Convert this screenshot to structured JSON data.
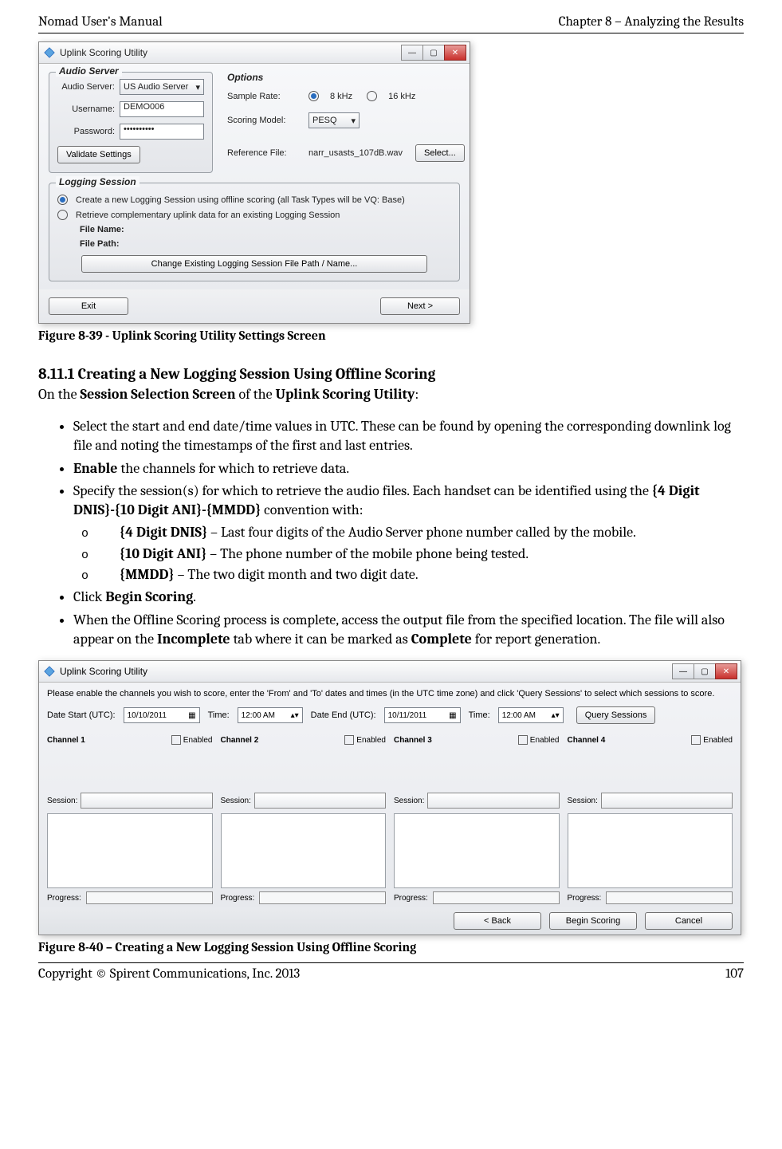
{
  "header": {
    "left": "Nomad User's Manual",
    "right": "Chapter 8 – Analyzing the Results"
  },
  "footer": {
    "left": "Copyright © Spirent Communications, Inc. 2013",
    "right": "107"
  },
  "figure1": {
    "title": "Uplink Scoring Utility",
    "audio_legend": "Audio Server",
    "audio_server_label": "Audio Server:",
    "audio_server_value": "US Audio Server",
    "username_label": "Username:",
    "username_value": "DEMO006",
    "password_label": "Password:",
    "password_value": "••••••••••",
    "validate_btn": "Validate Settings",
    "options_legend": "Options",
    "sample_rate_label": "Sample Rate:",
    "sample_rate_8": "8 kHz",
    "sample_rate_16": "16 kHz",
    "scoring_model_label": "Scoring Model:",
    "scoring_model_value": "PESQ",
    "reference_file_label": "Reference File:",
    "reference_file_value": "narr_usasts_107dB.wav",
    "select_btn": "Select...",
    "logging_legend": "Logging Session",
    "radio1": "Create a new Logging Session using offline scoring (all Task Types will be VQ: Base)",
    "radio2": "Retrieve complementary uplink data for an existing Logging Session",
    "file_name_label": "File Name:",
    "file_path_label": "File Path:",
    "change_btn": "Change Existing Logging Session File Path / Name...",
    "exit_btn": "Exit",
    "next_btn": "Next >",
    "caption": "Figure 8-39 - Uplink Scoring Utility Settings Screen"
  },
  "section": {
    "heading": "8.11.1  Creating a New Logging Session Using Offline Scoring",
    "intro_pre": "On the ",
    "intro_b1": "Session Selection Screen",
    "intro_mid": " of the ",
    "intro_b2": "Uplink Scoring Utility",
    "intro_post": ":",
    "b1": "Select the start and end date/time values in UTC.  These can be found by opening the corresponding downlink log file and noting the timestamps of the first and last entries.",
    "b2_pre": "",
    "b2_bold": "Enable",
    "b2_post": " the channels for which to retrieve data.",
    "b3_pre": "Specify the session(s) for which to retrieve the audio files.  Each handset can be identified using the ",
    "b3_bold": "{4 Digit DNIS}-{10 Digit ANI}-{MMDD}",
    "b3_post": " convention with:",
    "s1_bold": "{4 Digit DNIS}",
    "s1_txt": " – Last four digits of the Audio Server phone number called by the mobile.",
    "s2_bold": "{10 Digit ANI}",
    "s2_txt": " – The phone number of the mobile phone being tested.",
    "s3_bold": "{MMDD}",
    "s3_txt": " – The two digit month and two digit date.",
    "b4_pre": "Click ",
    "b4_bold": "Begin Scoring",
    "b4_post": ".",
    "b5_pre": "When the Offline Scoring process is complete, access the output file from the specified location.  The file will also appear on the ",
    "b5_bold1": "Incomplete",
    "b5_mid": " tab where it can be marked as ",
    "b5_bold2": "Complete",
    "b5_post": " for report generation."
  },
  "figure2": {
    "title": "Uplink Scoring Utility",
    "hint": "Please enable the channels you wish to score, enter the 'From' and 'To' dates and times (in the UTC time zone) and click 'Query Sessions' to select which sessions to score.",
    "date_start_label": "Date Start (UTC):",
    "date_start_value": "10/10/2011",
    "time_label": "Time:",
    "time_start_value": "12:00 AM",
    "date_end_label": "Date End (UTC):",
    "date_end_value": "10/11/2011",
    "time_end_value": "12:00 AM",
    "query_btn": "Query Sessions",
    "enabled_label": "Enabled",
    "channel1": "Channel 1",
    "channel2": "Channel 2",
    "channel3": "Channel 3",
    "channel4": "Channel 4",
    "session_label": "Session:",
    "progress_label": "Progress:",
    "back_btn": "<  Back",
    "begin_btn": "Begin Scoring",
    "cancel_btn": "Cancel",
    "caption": "Figure 8-40 – Creating a New Logging Session Using Offline Scoring"
  }
}
